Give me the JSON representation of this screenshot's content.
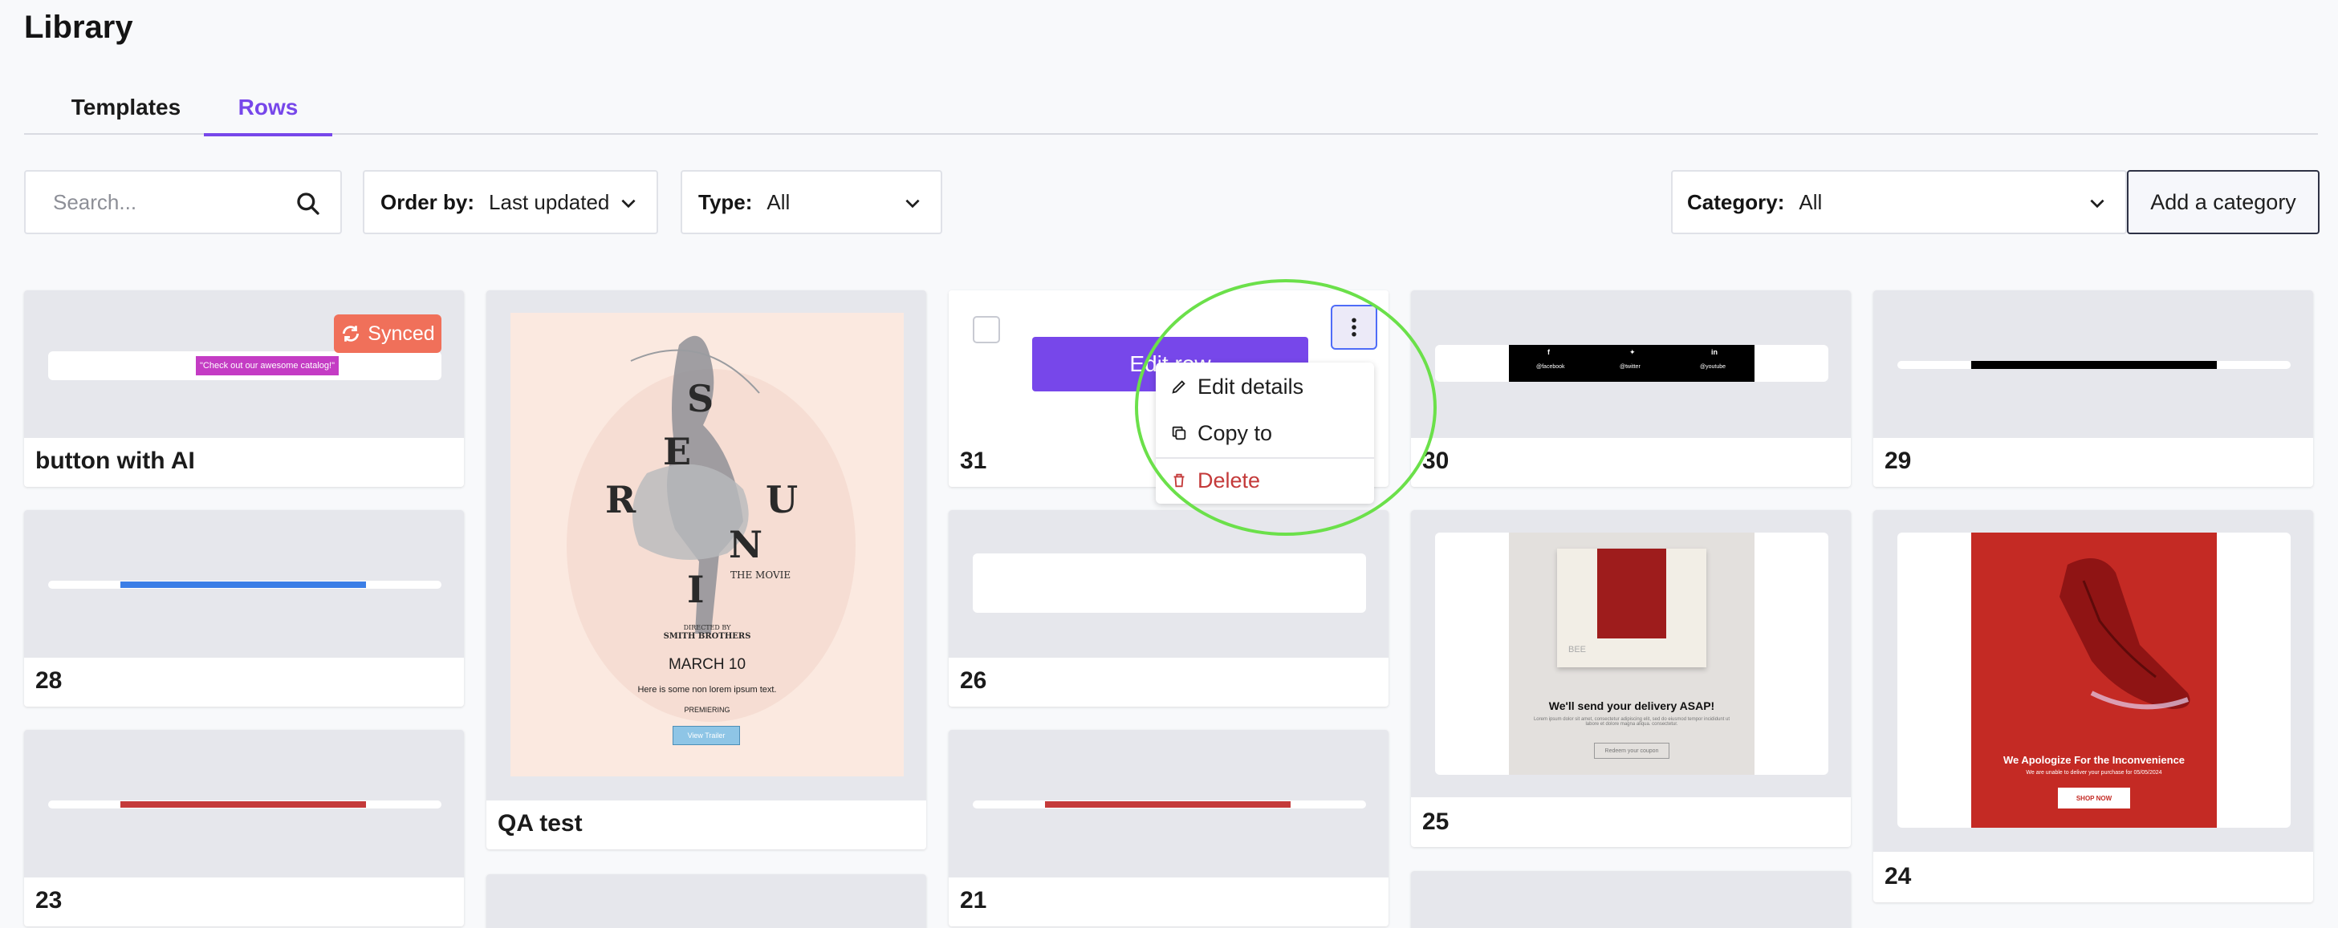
{
  "page": {
    "title": "Library"
  },
  "tabs": [
    {
      "label": "Templates",
      "active": false
    },
    {
      "label": "Rows",
      "active": true
    }
  ],
  "toolbar": {
    "search_placeholder": "Search...",
    "order_by_label": "Order by:",
    "order_by_value": "Last updated",
    "type_label": "Type:",
    "type_value": "All",
    "category_label": "Category:",
    "category_value": "All",
    "add_category_label": "Add a category"
  },
  "accent_color": "#7747ea",
  "cards": {
    "button_ai": {
      "title": "button with AI",
      "badge": "Synced",
      "preview_text": "\"Check out our awesome catalog!\""
    },
    "qa_test": {
      "title": "QA test",
      "poster": {
        "letters": [
          "S",
          "E",
          "R",
          "U",
          "N",
          "I"
        ],
        "tagline": "THE MOVIE",
        "directed_by": "DIRECTED BY",
        "director": "SMITH BROTHERS",
        "date": "MARCH 10",
        "body": "Here is some non lorem ipsum text.",
        "premiering": "PREMIERING",
        "button": "View Trailer"
      }
    },
    "row31": {
      "title": "31",
      "edit_label": "Edit row"
    },
    "row30": {
      "title": "30",
      "social": [
        "@facebook",
        "@twitter",
        "@youtube"
      ]
    },
    "row29": {
      "title": "29"
    },
    "row28": {
      "title": "28"
    },
    "row26": {
      "title": "26"
    },
    "row25": {
      "title": "25",
      "headline": "We'll send your delivery ASAP!",
      "body": "Lorem ipsum dolor sit amet, consectetur adipiscing elit, sed do eiusmod tempor incididunt ut labore et dolore magna aliqua. consectetur.",
      "button": "Redeem your coupon",
      "box_brand": "BEE"
    },
    "row24": {
      "title": "24",
      "headline": "We Apologize For the Inconvenience",
      "body": "We are unable to deliver your purchase for 05/05/2024",
      "button": "SHOP NOW"
    },
    "row23": {
      "title": "23"
    },
    "row21": {
      "title": "21"
    }
  },
  "context_menu": {
    "items": [
      {
        "label": "Edit details"
      },
      {
        "label": "Copy to"
      },
      {
        "label": "Delete"
      }
    ]
  }
}
